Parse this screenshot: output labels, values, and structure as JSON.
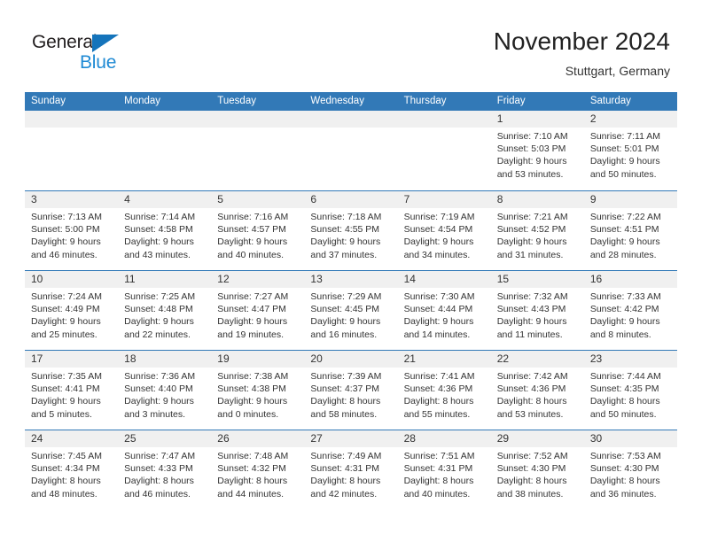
{
  "brand": {
    "name_top": "General",
    "name_bottom": "Blue",
    "triangle_color": "#1574bb",
    "blue_color": "#1f8ad4",
    "dark_color": "#231f20"
  },
  "header": {
    "title": "November 2024",
    "location": "Stuttgart, Germany"
  },
  "theme": {
    "header_blue": "#3279b7",
    "daynum_gray": "#f0f0f0",
    "text_color": "#333333",
    "background": "#ffffff"
  },
  "weekdays": [
    "Sunday",
    "Monday",
    "Tuesday",
    "Wednesday",
    "Thursday",
    "Friday",
    "Saturday"
  ],
  "weeks": [
    [
      {
        "empty": true
      },
      {
        "empty": true
      },
      {
        "empty": true
      },
      {
        "empty": true
      },
      {
        "empty": true
      },
      {
        "day": "1",
        "sunrise": "Sunrise: 7:10 AM",
        "sunset": "Sunset: 5:03 PM",
        "daylight1": "Daylight: 9 hours",
        "daylight2": "and 53 minutes."
      },
      {
        "day": "2",
        "sunrise": "Sunrise: 7:11 AM",
        "sunset": "Sunset: 5:01 PM",
        "daylight1": "Daylight: 9 hours",
        "daylight2": "and 50 minutes."
      }
    ],
    [
      {
        "day": "3",
        "sunrise": "Sunrise: 7:13 AM",
        "sunset": "Sunset: 5:00 PM",
        "daylight1": "Daylight: 9 hours",
        "daylight2": "and 46 minutes."
      },
      {
        "day": "4",
        "sunrise": "Sunrise: 7:14 AM",
        "sunset": "Sunset: 4:58 PM",
        "daylight1": "Daylight: 9 hours",
        "daylight2": "and 43 minutes."
      },
      {
        "day": "5",
        "sunrise": "Sunrise: 7:16 AM",
        "sunset": "Sunset: 4:57 PM",
        "daylight1": "Daylight: 9 hours",
        "daylight2": "and 40 minutes."
      },
      {
        "day": "6",
        "sunrise": "Sunrise: 7:18 AM",
        "sunset": "Sunset: 4:55 PM",
        "daylight1": "Daylight: 9 hours",
        "daylight2": "and 37 minutes."
      },
      {
        "day": "7",
        "sunrise": "Sunrise: 7:19 AM",
        "sunset": "Sunset: 4:54 PM",
        "daylight1": "Daylight: 9 hours",
        "daylight2": "and 34 minutes."
      },
      {
        "day": "8",
        "sunrise": "Sunrise: 7:21 AM",
        "sunset": "Sunset: 4:52 PM",
        "daylight1": "Daylight: 9 hours",
        "daylight2": "and 31 minutes."
      },
      {
        "day": "9",
        "sunrise": "Sunrise: 7:22 AM",
        "sunset": "Sunset: 4:51 PM",
        "daylight1": "Daylight: 9 hours",
        "daylight2": "and 28 minutes."
      }
    ],
    [
      {
        "day": "10",
        "sunrise": "Sunrise: 7:24 AM",
        "sunset": "Sunset: 4:49 PM",
        "daylight1": "Daylight: 9 hours",
        "daylight2": "and 25 minutes."
      },
      {
        "day": "11",
        "sunrise": "Sunrise: 7:25 AM",
        "sunset": "Sunset: 4:48 PM",
        "daylight1": "Daylight: 9 hours",
        "daylight2": "and 22 minutes."
      },
      {
        "day": "12",
        "sunrise": "Sunrise: 7:27 AM",
        "sunset": "Sunset: 4:47 PM",
        "daylight1": "Daylight: 9 hours",
        "daylight2": "and 19 minutes."
      },
      {
        "day": "13",
        "sunrise": "Sunrise: 7:29 AM",
        "sunset": "Sunset: 4:45 PM",
        "daylight1": "Daylight: 9 hours",
        "daylight2": "and 16 minutes."
      },
      {
        "day": "14",
        "sunrise": "Sunrise: 7:30 AM",
        "sunset": "Sunset: 4:44 PM",
        "daylight1": "Daylight: 9 hours",
        "daylight2": "and 14 minutes."
      },
      {
        "day": "15",
        "sunrise": "Sunrise: 7:32 AM",
        "sunset": "Sunset: 4:43 PM",
        "daylight1": "Daylight: 9 hours",
        "daylight2": "and 11 minutes."
      },
      {
        "day": "16",
        "sunrise": "Sunrise: 7:33 AM",
        "sunset": "Sunset: 4:42 PM",
        "daylight1": "Daylight: 9 hours",
        "daylight2": "and 8 minutes."
      }
    ],
    [
      {
        "day": "17",
        "sunrise": "Sunrise: 7:35 AM",
        "sunset": "Sunset: 4:41 PM",
        "daylight1": "Daylight: 9 hours",
        "daylight2": "and 5 minutes."
      },
      {
        "day": "18",
        "sunrise": "Sunrise: 7:36 AM",
        "sunset": "Sunset: 4:40 PM",
        "daylight1": "Daylight: 9 hours",
        "daylight2": "and 3 minutes."
      },
      {
        "day": "19",
        "sunrise": "Sunrise: 7:38 AM",
        "sunset": "Sunset: 4:38 PM",
        "daylight1": "Daylight: 9 hours",
        "daylight2": "and 0 minutes."
      },
      {
        "day": "20",
        "sunrise": "Sunrise: 7:39 AM",
        "sunset": "Sunset: 4:37 PM",
        "daylight1": "Daylight: 8 hours",
        "daylight2": "and 58 minutes."
      },
      {
        "day": "21",
        "sunrise": "Sunrise: 7:41 AM",
        "sunset": "Sunset: 4:36 PM",
        "daylight1": "Daylight: 8 hours",
        "daylight2": "and 55 minutes."
      },
      {
        "day": "22",
        "sunrise": "Sunrise: 7:42 AM",
        "sunset": "Sunset: 4:36 PM",
        "daylight1": "Daylight: 8 hours",
        "daylight2": "and 53 minutes."
      },
      {
        "day": "23",
        "sunrise": "Sunrise: 7:44 AM",
        "sunset": "Sunset: 4:35 PM",
        "daylight1": "Daylight: 8 hours",
        "daylight2": "and 50 minutes."
      }
    ],
    [
      {
        "day": "24",
        "sunrise": "Sunrise: 7:45 AM",
        "sunset": "Sunset: 4:34 PM",
        "daylight1": "Daylight: 8 hours",
        "daylight2": "and 48 minutes."
      },
      {
        "day": "25",
        "sunrise": "Sunrise: 7:47 AM",
        "sunset": "Sunset: 4:33 PM",
        "daylight1": "Daylight: 8 hours",
        "daylight2": "and 46 minutes."
      },
      {
        "day": "26",
        "sunrise": "Sunrise: 7:48 AM",
        "sunset": "Sunset: 4:32 PM",
        "daylight1": "Daylight: 8 hours",
        "daylight2": "and 44 minutes."
      },
      {
        "day": "27",
        "sunrise": "Sunrise: 7:49 AM",
        "sunset": "Sunset: 4:31 PM",
        "daylight1": "Daylight: 8 hours",
        "daylight2": "and 42 minutes."
      },
      {
        "day": "28",
        "sunrise": "Sunrise: 7:51 AM",
        "sunset": "Sunset: 4:31 PM",
        "daylight1": "Daylight: 8 hours",
        "daylight2": "and 40 minutes."
      },
      {
        "day": "29",
        "sunrise": "Sunrise: 7:52 AM",
        "sunset": "Sunset: 4:30 PM",
        "daylight1": "Daylight: 8 hours",
        "daylight2": "and 38 minutes."
      },
      {
        "day": "30",
        "sunrise": "Sunrise: 7:53 AM",
        "sunset": "Sunset: 4:30 PM",
        "daylight1": "Daylight: 8 hours",
        "daylight2": "and 36 minutes."
      }
    ]
  ]
}
